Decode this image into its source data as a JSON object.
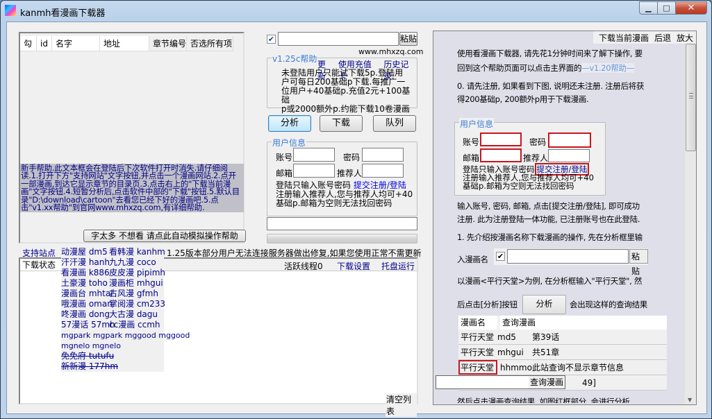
{
  "window": {
    "title": "kanmh看漫画下载器",
    "controls": {
      "minimize": "▁",
      "maximize": "□",
      "close": "✕"
    }
  },
  "chapter_list": {
    "columns": [
      "勾",
      "id",
      "名字",
      "地址",
      "章节编号",
      "否选所有项"
    ]
  },
  "newbie_help": {
    "text": "新手帮助.此文本框会在登陆后下次软件打开时消失.请仔细阅读.1.打开下方\"支持网站\"文字按钮,并点击一个漫画网站.2.点开一部漫画,到达它显示章节的目录页.3.点击右上的\"下载当前漫画\"文字按钮.4.短暂分析后,点击软件中部的\"下载\"按钮.5.默认目录\"D:\\download\\cartoon\"去看您已经下好的漫画吧.5.点击\"v1.xx帮助\"到官网www.mhxzq.com,有详细帮助.",
    "auto_help_button": "字太多 不想看 请点此自动模拟操作帮助"
  },
  "analysis_bar": {
    "checkbox_checked": true,
    "url_input_value": "",
    "paste_button": "粘贴",
    "site": "www.mhxzq.com"
  },
  "version_group": {
    "title": "v1.25c帮助",
    "links": [
      "更新",
      "使用充值卡",
      "历史记录"
    ],
    "lines": [
      "未登陆用户只能试下载5p.登陆用",
      "户可每日200基础p下载.每推广一",
      "位用户+40基础p.充值2元+100基础",
      "p或2000额外p.约能下载10卷漫画"
    ]
  },
  "actions": {
    "analyze": "分析",
    "download": "下载",
    "queue": "队列"
  },
  "user_info": {
    "title": "用户信息",
    "account_label": "账号",
    "password_label": "密码",
    "email_label": "邮箱",
    "referrer_label": "推荐人",
    "account_value": "",
    "password_value": "",
    "email_value": "",
    "referrer_value": "",
    "login_hint": "登陆只输入账号密码",
    "submit_link": "提交注册/登陆",
    "note_line1": "注册输入推荐人,您与推荐人均可+40",
    "note_line2": "基础p.邮箱为空则无法找回密码"
  },
  "status_input_value": "",
  "progress": 0,
  "support_sites": {
    "label": "支持站点",
    "rows": [
      [
        {
          "name": "动漫屋 dm5"
        },
        {
          "name": "看韩漫 kanhm"
        }
      ],
      [
        {
          "name": "汗汗漫 hanh"
        },
        {
          "name": "九九漫 coco"
        }
      ],
      [
        {
          "name": "看漫画 k886"
        },
        {
          "name": "皮皮漫 pipimh"
        }
      ],
      [
        {
          "name": "土豪漫 toho"
        },
        {
          "name": "漫画柜 mhgui"
        }
      ],
      [
        {
          "name": "漫画台 mhtai"
        },
        {
          "name": "古风漫 gfmh"
        }
      ],
      [
        {
          "name": "哦漫画 oman"
        },
        {
          "name": "掌阅漫 cm233"
        }
      ],
      [
        {
          "name": "咚漫画 dong"
        },
        {
          "name": "大古漫 dagu"
        }
      ],
      [
        {
          "name": "57漫话 57mh"
        },
        {
          "name": "cc漫画 ccmh"
        }
      ]
    ],
    "extra": [
      "mgpark mgpark mggood mggood",
      "mgnelo mgnelo"
    ],
    "disabled": [
      "免免府 tutufu",
      "新新漫 177hm"
    ]
  },
  "notice": "1.25版本部分用户无法连接服务器做出修复,如果您使用正常不需更新",
  "download_list": {
    "status_column": "下载状态",
    "active_threads": "活跃线程0",
    "settings_link": "下载设置",
    "tray_link": "托盘运行",
    "clear_button": "清空列表"
  },
  "help_panel": {
    "toolbar": [
      "下载当前漫画",
      "后退",
      "放大"
    ],
    "p1_line1": "使用看漫画下载器, 请先花1分钟时间来了解下操作, 要",
    "p1_line2": "回到这个帮助页面可以点击主界面的",
    "p1_version_link": "v1.20帮助",
    "p2_line1": "0. 请先注册, 如果看到下图, 说明还未注册. 注册后将获",
    "p2_line2": "得200基础p, 200额外p用于下载漫画.",
    "example_user_info": {
      "title": "用户信息",
      "account_label": "账号",
      "password_label": "密码",
      "email_label": "邮箱",
      "referrer_label": "推荐人",
      "login_hint": "登陆只输入账号密码",
      "submit_link": "提交注册/登陆",
      "note_line1": "注册输入推荐人,您与推荐人均可+40",
      "note_line2": "基础p.邮箱为空则无法找回密码"
    },
    "p3_line1": "输入账号, 密码, 邮箱, 点击[提交注册/登陆], 即可成功",
    "p3_line2": "注册. 此为注册登陆一体功能, 已注册账号也在此登陆.",
    "p4_line1": "1. 先介绍按漫画名称下载漫画的操作, 先在分析框里输",
    "p4_line2": "入漫画名",
    "example_paste": "粘贴",
    "p5_line1": "以漫画<平行天堂>为例, 在分析框输入\"平行天堂\", 然",
    "p5_line2_pre": "后点击[分析]按钮",
    "example_analyze": "分析",
    "p5_line2_post": "会出现这样的查询结果",
    "results": {
      "header": [
        "漫画名",
        "查询漫画"
      ],
      "rows": [
        {
          "name": "平行天堂",
          "site": "md5",
          "info": "第39话"
        },
        {
          "name": "平行天堂",
          "site": "mhgui",
          "info": "共51章"
        },
        {
          "name": "平行天堂",
          "site": "hhmmo",
          "info": "此站查询不显示章节信息"
        },
        {
          "name": "",
          "site": "",
          "info": "49]"
        }
      ]
    },
    "p6_partial": "然后点击漫画查询结果, 如图红框部分, 会进行分析"
  },
  "floating_search": {
    "value": "",
    "button": "查询漫画"
  }
}
